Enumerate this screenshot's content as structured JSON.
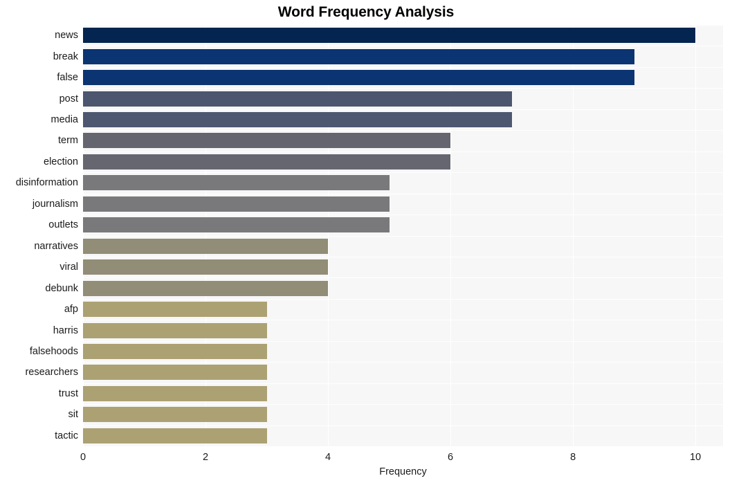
{
  "chart_data": {
    "type": "bar",
    "orientation": "horizontal",
    "title": "Word Frequency Analysis",
    "xlabel": "Frequency",
    "ylabel": "",
    "xlim": [
      0,
      10.45
    ],
    "xticks": [
      0,
      2,
      4,
      6,
      8,
      10
    ],
    "xticklabels": [
      "0",
      "2",
      "4",
      "6",
      "8",
      "10"
    ],
    "grid": true,
    "legend": null,
    "categories": [
      "news",
      "break",
      "false",
      "post",
      "media",
      "term",
      "election",
      "disinformation",
      "journalism",
      "outlets",
      "narratives",
      "viral",
      "debunk",
      "afp",
      "harris",
      "falsehoods",
      "researchers",
      "trust",
      "sit",
      "tactic"
    ],
    "values": [
      10,
      9,
      9,
      7,
      7,
      6,
      6,
      5,
      5,
      5,
      4,
      4,
      4,
      3,
      3,
      3,
      3,
      3,
      3,
      3
    ],
    "bar_colors": [
      "#04254f",
      "#0b3472",
      "#0b3473",
      "#4d566f",
      "#4e5770",
      "#64656f",
      "#65666f",
      "#79787a",
      "#79787a",
      "#79787a",
      "#918d76",
      "#918d76",
      "#918d76",
      "#aca173",
      "#aca173",
      "#aca173",
      "#aca173",
      "#aca173",
      "#aca173",
      "#aca173"
    ],
    "plot_background": "#f7f7f7",
    "figure_background": "#ffffff",
    "gridline_color": "#ffffff",
    "text_color": "#1a1a1a"
  }
}
